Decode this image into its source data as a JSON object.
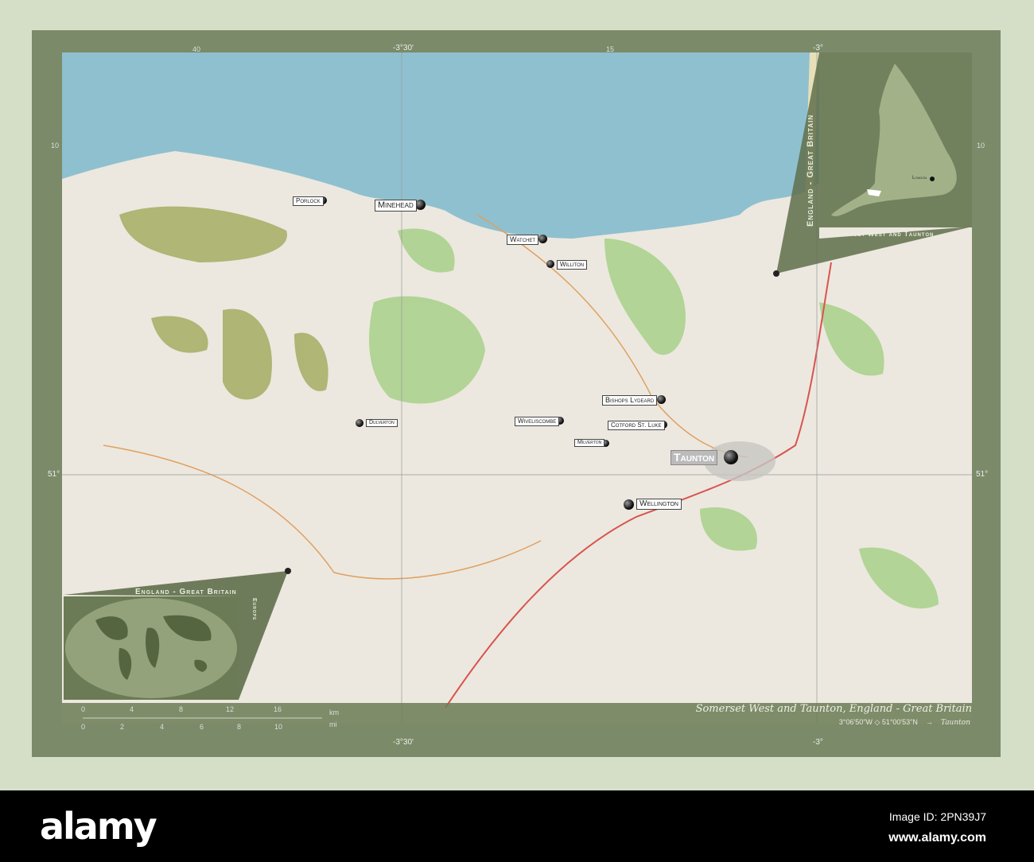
{
  "map": {
    "title": "Somerset West and Taunton, England - Great Britain",
    "coordinates": "3°06'50\"W ◇ 51°00'53\"N",
    "arrow": "→",
    "capital": "Taunton",
    "grid": {
      "lon1": "-3°30'",
      "lon2": "-3°",
      "lat": "51°",
      "minor_top_left": "40",
      "minor_top_right": "15",
      "minor_left": "10",
      "minor_right": "10"
    },
    "places": [
      {
        "name": "Porlock"
      },
      {
        "name": "Minehead"
      },
      {
        "name": "Watchet"
      },
      {
        "name": "Williton"
      },
      {
        "name": "Bishops Lydeard"
      },
      {
        "name": "Wiveliscombe"
      },
      {
        "name": "Cotford St. Luke"
      },
      {
        "name": "Milverton"
      },
      {
        "name": "Dulverton"
      },
      {
        "name": "Taunton"
      },
      {
        "name": "Wellington"
      }
    ],
    "scale": {
      "km_unit": "km",
      "mi_unit": "mi",
      "km_ticks": [
        "0",
        "4",
        "8",
        "12",
        "16"
      ],
      "mi_ticks": [
        "0",
        "2",
        "4",
        "6",
        "8",
        "10"
      ]
    },
    "colors": {
      "frame": "#7b8a68",
      "sea": "#8fc0cf",
      "land": "#ece8df",
      "forest": "#a8d08a",
      "moor": "#a8b06a"
    }
  },
  "inset_country": {
    "title": "England - Great Britain",
    "region": "Somerset West and Taunton",
    "city": "London"
  },
  "inset_world": {
    "title": "England - Great Britain",
    "continent": "Europe"
  },
  "footer": {
    "logo": "alamy",
    "image_id": "Image ID: 2PN39J7",
    "url": "www.alamy.com"
  }
}
